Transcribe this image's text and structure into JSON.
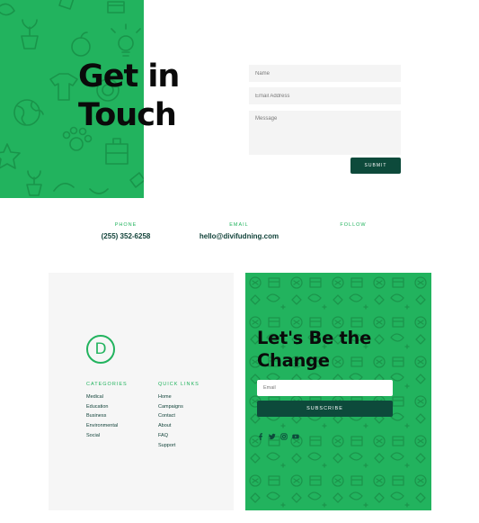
{
  "hero": {
    "title": "Get in Touch"
  },
  "contact_form": {
    "name_placeholder": "Name",
    "email_placeholder": "Email Address",
    "message_placeholder": "Message",
    "submit_label": "SUBMIT"
  },
  "contact_info": {
    "phone_label": "PHONE",
    "phone_value": "(255) 352-6258",
    "email_label": "EMAIL",
    "email_value": "hello@divifudning.com",
    "follow_label": "FOLLOW"
  },
  "footer": {
    "logo_letter": "D",
    "categories": {
      "title": "CATEGORIES",
      "items": [
        "Medical",
        "Education",
        "Business",
        "Environmental",
        "Social"
      ]
    },
    "quick_links": {
      "title": "QUICK LINKS",
      "items": [
        "Home",
        "Campaigns",
        "Contact",
        "About",
        "FAQ",
        "Support"
      ]
    },
    "newsletter": {
      "title": "Let's Be the Change",
      "email_placeholder": "Email",
      "subscribe_label": "SUBSCRIBE"
    },
    "social_icons": [
      "facebook-icon",
      "twitter-icon",
      "instagram-icon",
      "youtube-icon"
    ]
  },
  "colors": {
    "brand_green": "#22b35e",
    "pattern_green": "#178a44",
    "dark_teal": "#0d4a3b",
    "text_dark": "#12433a",
    "field_bg": "#f4f4f4",
    "footer_bg": "#f6f6f6"
  }
}
